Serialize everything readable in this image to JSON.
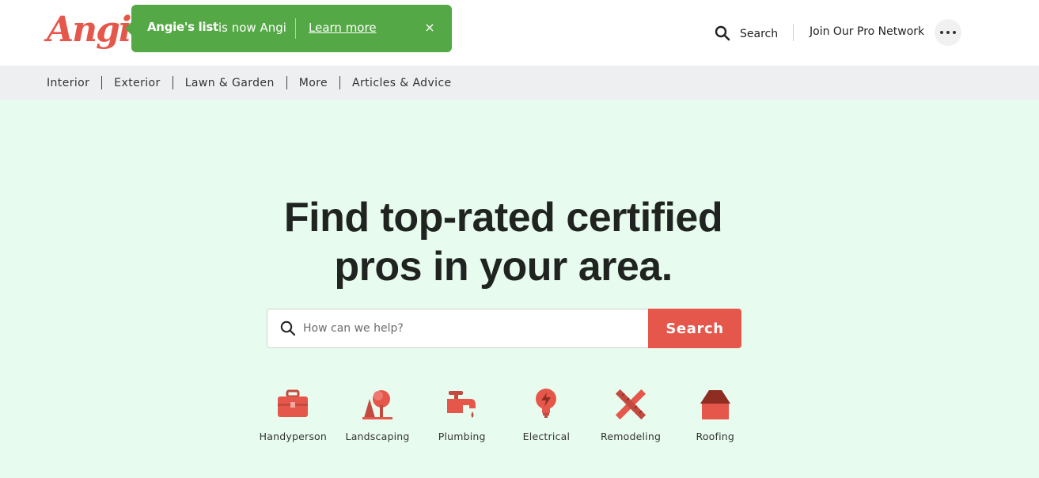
{
  "header": {
    "logo_text": "Angi",
    "banner": {
      "brand": "Angie's list",
      "text": "is now Angi",
      "link_label": "Learn more",
      "close_glyph": "×"
    },
    "search_label": "Search",
    "join_label": "Join Our Pro Network",
    "more_icon": "ellipsis-icon"
  },
  "nav": {
    "items": [
      "Interior",
      "Exterior",
      "Lawn & Garden",
      "More",
      "Articles & Advice"
    ]
  },
  "hero": {
    "headline_line1": "Find top-rated certified",
    "headline_line2": "pros in your area.",
    "search_placeholder": "How can we help?",
    "search_button": "Search",
    "categories": [
      {
        "label": "Handyperson",
        "icon": "toolbox-icon"
      },
      {
        "label": "Landscaping",
        "icon": "tree-icon"
      },
      {
        "label": "Plumbing",
        "icon": "faucet-icon"
      },
      {
        "label": "Electrical",
        "icon": "lightbulb-icon"
      },
      {
        "label": "Remodeling",
        "icon": "ruler-pencil-icon"
      },
      {
        "label": "Roofing",
        "icon": "house-roof-icon"
      }
    ]
  },
  "colors": {
    "brand": "#e5574a",
    "banner": "#55a846",
    "hero_bg": "#e8fbef",
    "nav_bg": "#eeeff1"
  }
}
